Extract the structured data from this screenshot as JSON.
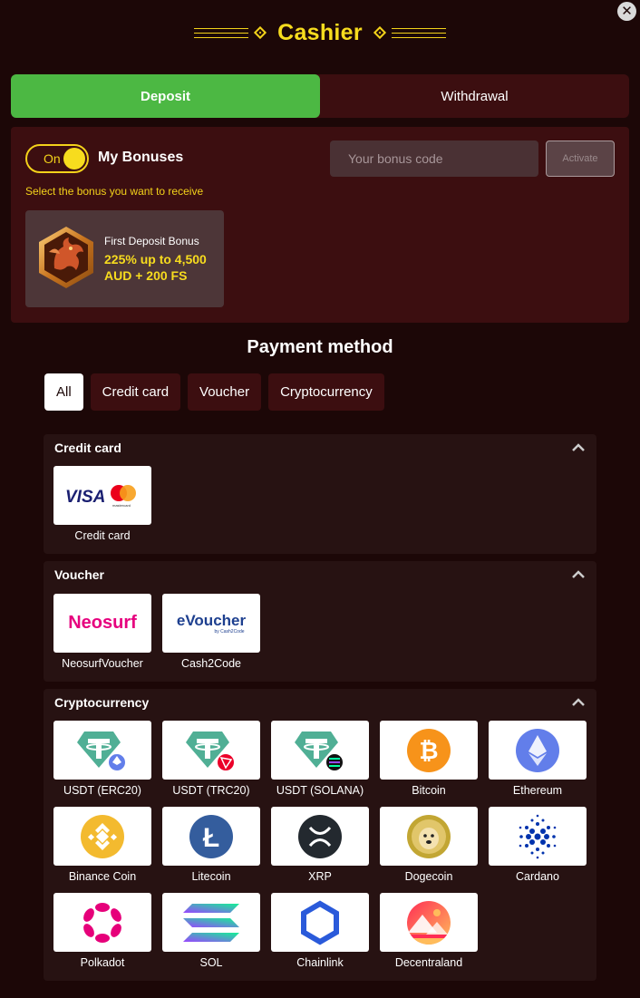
{
  "title": "Cashier",
  "close_label": "✕",
  "tabs": [
    {
      "label": "Deposit",
      "active": true
    },
    {
      "label": "Withdrawal",
      "active": false
    }
  ],
  "bonus": {
    "toggle_label": "On",
    "title": "My Bonuses",
    "hint": "Select the bonus you want to receive",
    "code_placeholder": "Your bonus code",
    "activate_label": "Activate",
    "card": {
      "title": "First Deposit Bonus",
      "amount": "225% up to 4,500 AUD + 200 FS"
    }
  },
  "payment": {
    "title": "Payment method",
    "filters": [
      "All",
      "Credit card",
      "Voucher",
      "Cryptocurrency"
    ],
    "sections": [
      {
        "title": "Credit card",
        "methods": [
          {
            "label": "Credit card",
            "icon": "visa-mastercard-logo"
          }
        ]
      },
      {
        "title": "Voucher",
        "methods": [
          {
            "label": "NeosurfVoucher",
            "icon": "neosurf-logo",
            "logo_text": "Neosurf"
          },
          {
            "label": "Cash2Code",
            "icon": "evoucher-logo",
            "logo_text": "eVoucher",
            "logo_sub": "by Cash2Code"
          }
        ]
      },
      {
        "title": "Cryptocurrency",
        "methods": [
          {
            "label": "USDT (ERC20)",
            "icon": "tether-erc20-icon"
          },
          {
            "label": "USDT (TRC20)",
            "icon": "tether-trc20-icon"
          },
          {
            "label": "USDT (SOLANA)",
            "icon": "tether-solana-icon"
          },
          {
            "label": "Bitcoin",
            "icon": "bitcoin-icon"
          },
          {
            "label": "Ethereum",
            "icon": "ethereum-icon"
          },
          {
            "label": "Binance Coin",
            "icon": "binance-icon"
          },
          {
            "label": "Litecoin",
            "icon": "litecoin-icon"
          },
          {
            "label": "XRP",
            "icon": "xrp-icon"
          },
          {
            "label": "Dogecoin",
            "icon": "dogecoin-icon"
          },
          {
            "label": "Cardano",
            "icon": "cardano-icon"
          },
          {
            "label": "Polkadot",
            "icon": "polkadot-icon"
          },
          {
            "label": "SOL",
            "icon": "solana-icon"
          },
          {
            "label": "Chainlink",
            "icon": "chainlink-icon"
          },
          {
            "label": "Decentraland",
            "icon": "decentraland-icon"
          }
        ]
      }
    ]
  },
  "colors": {
    "background": "#1c0707",
    "panel": "#3c0e10",
    "accent_yellow": "#f7dc1e",
    "deposit_green": "#4cb843"
  }
}
